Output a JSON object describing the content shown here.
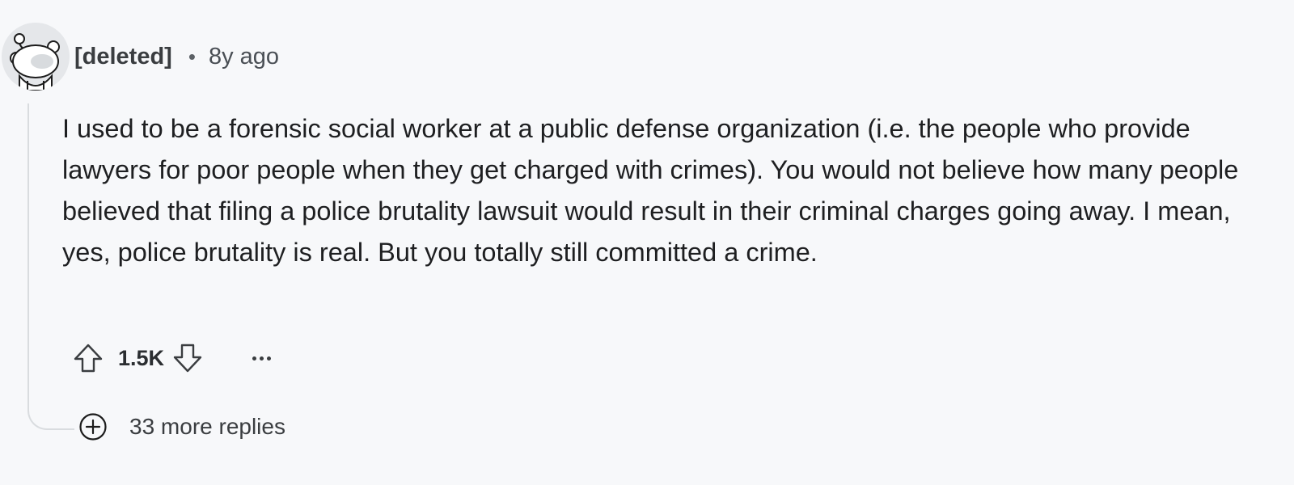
{
  "comment": {
    "author": "[deleted]",
    "separator": "•",
    "timestamp": "8y ago",
    "body": "I used to be a forensic social worker at a public defense organization (i.e. the people who provide lawyers for poor people when they get charged with crimes). You would not believe how many people believed that filing a police brutality lawsuit would result in their criminal charges going away. I mean, yes, police brutality is real. But you totally still committed a crime.",
    "score": "1.5K",
    "more_replies": "33 more replies"
  },
  "icons": {
    "avatar": "snoo-avatar-icon",
    "upvote": "upvote-arrow-icon",
    "downvote": "downvote-arrow-icon",
    "more": "ellipsis-icon",
    "expand": "plus-circle-icon"
  },
  "colors": {
    "background": "#f7f8fa",
    "text": "#1e1f21",
    "muted": "#4a4f55",
    "thread_line": "#d9dcdf"
  }
}
